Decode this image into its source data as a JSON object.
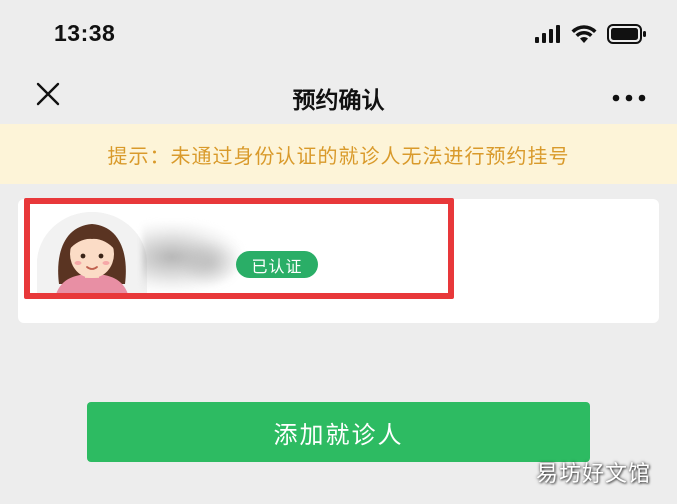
{
  "status_bar": {
    "time": "13:38",
    "icons": [
      "signal-icon",
      "wifi-icon",
      "battery-icon"
    ]
  },
  "nav": {
    "title": "预约确认",
    "close_icon": "close-icon",
    "more_icon": "more-icon"
  },
  "tip": {
    "text": "提示：未通过身份认证的就诊人无法进行预约挂号"
  },
  "patient": {
    "avatar": "avatar-female",
    "badge": "已认证"
  },
  "actions": {
    "add_patient": "添加就诊人"
  },
  "watermark": "易坊好文馆",
  "colors": {
    "background": "#ededed",
    "tip_bg": "#fdf4d8",
    "tip_text": "#d99a2b",
    "badge_green": "#2aae67",
    "button_green": "#2dbb62",
    "highlight_red": "#e8383a"
  }
}
